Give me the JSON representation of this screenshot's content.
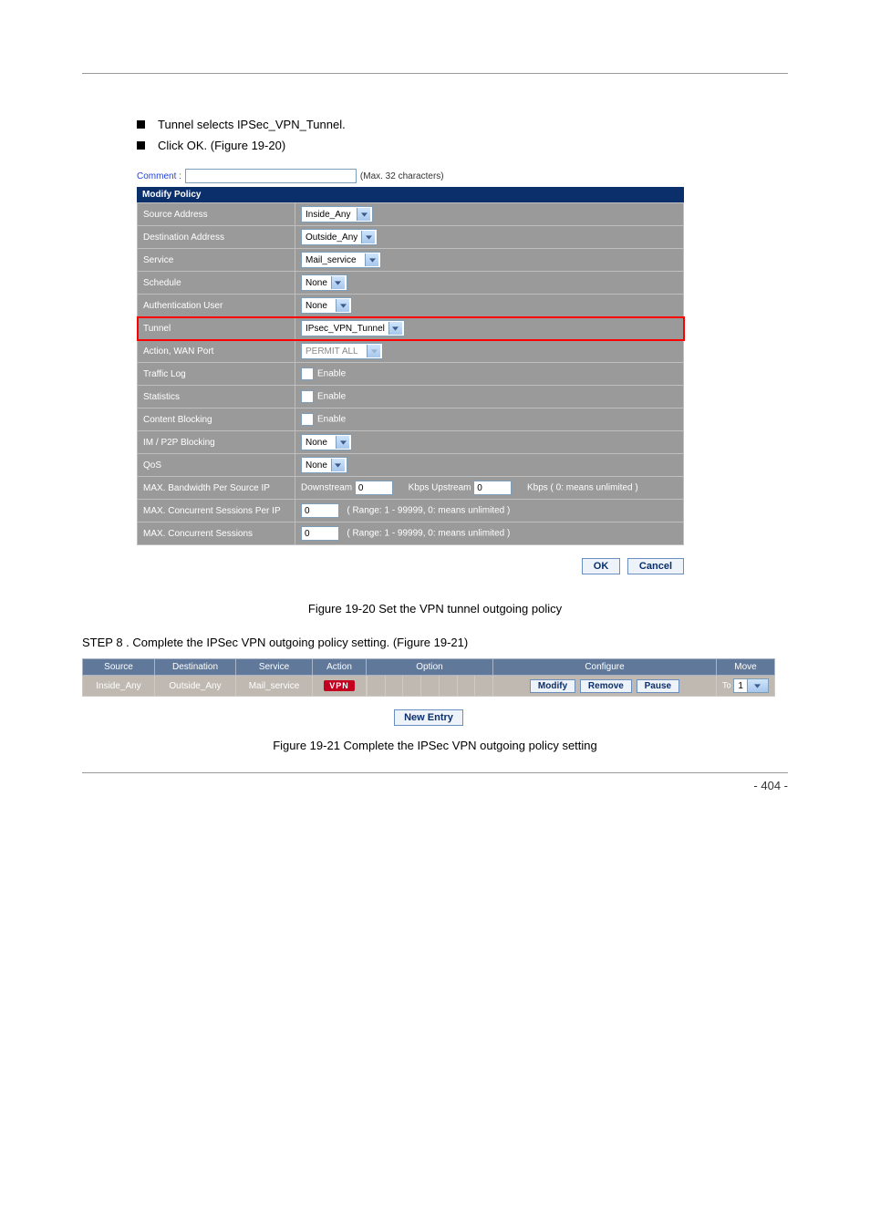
{
  "intro": {
    "line1": "Tunnel selects IPSec_VPN_Tunnel.",
    "line2": "Click OK. (Figure 19-20)"
  },
  "form": {
    "commentLabel": "Comment :",
    "commentNote": "(Max. 32 characters)",
    "panelTitle": "Modify Policy",
    "rows": {
      "srcLabel": "Source Address",
      "srcVal": "Inside_Any",
      "dstLabel": "Destination Address",
      "dstVal": "Outside_Any",
      "svcLabel": "Service",
      "svcVal": "Mail_service",
      "schLabel": "Schedule",
      "schVal": "None",
      "authLabel": "Authentication User",
      "authVal": "None",
      "tunLabel": "Tunnel",
      "tunVal": "IPsec_VPN_Tunnel",
      "actLabel": "Action, WAN Port",
      "actVal": "PERMIT ALL",
      "tlogLabel": "Traffic Log",
      "enable": "Enable",
      "statLabel": "Statistics",
      "cbLabel": "Content Blocking",
      "imLabel": "IM / P2P Blocking",
      "imVal": "None",
      "qosLabel": "QoS",
      "qosVal": "None",
      "bwLabel": "MAX. Bandwidth Per Source IP",
      "down": "Downstream",
      "downV": "0",
      "kup": "Kbps Upstream",
      "upV": "0",
      "kunl": "Kbps ( 0: means unlimited )",
      "csipLabel": "MAX. Concurrent Sessions Per IP",
      "csipV": "0",
      "csLabel": "MAX. Concurrent Sessions",
      "csV": "0",
      "rangeNote": "( Range: 1 - 99999, 0: means unlimited )"
    },
    "ok": "OK",
    "cancel": "Cancel"
  },
  "caption1": "Figure 19-20 Set the VPN tunnel outgoing policy",
  "step": "STEP 8 . Complete the IPSec VPN outgoing policy setting. (Figure 19-21)",
  "ptable": {
    "headers": {
      "src": "Source",
      "dst": "Destination",
      "svc": "Service",
      "act": "Action",
      "opt": "Option",
      "cfg": "Configure",
      "mv": "Move"
    },
    "row": {
      "src": "Inside_Any",
      "dst": "Outside_Any",
      "svc": "Mail_service",
      "vpn": "VPN"
    },
    "cfg": {
      "mod": "Modify",
      "rem": "Remove",
      "pau": "Pause"
    },
    "moveTo": "To",
    "moveNum": "1",
    "newEntry": "New Entry"
  },
  "caption2": "Figure 19-21 Complete the IPSec VPN outgoing policy setting",
  "pageNum": "- 404 -"
}
